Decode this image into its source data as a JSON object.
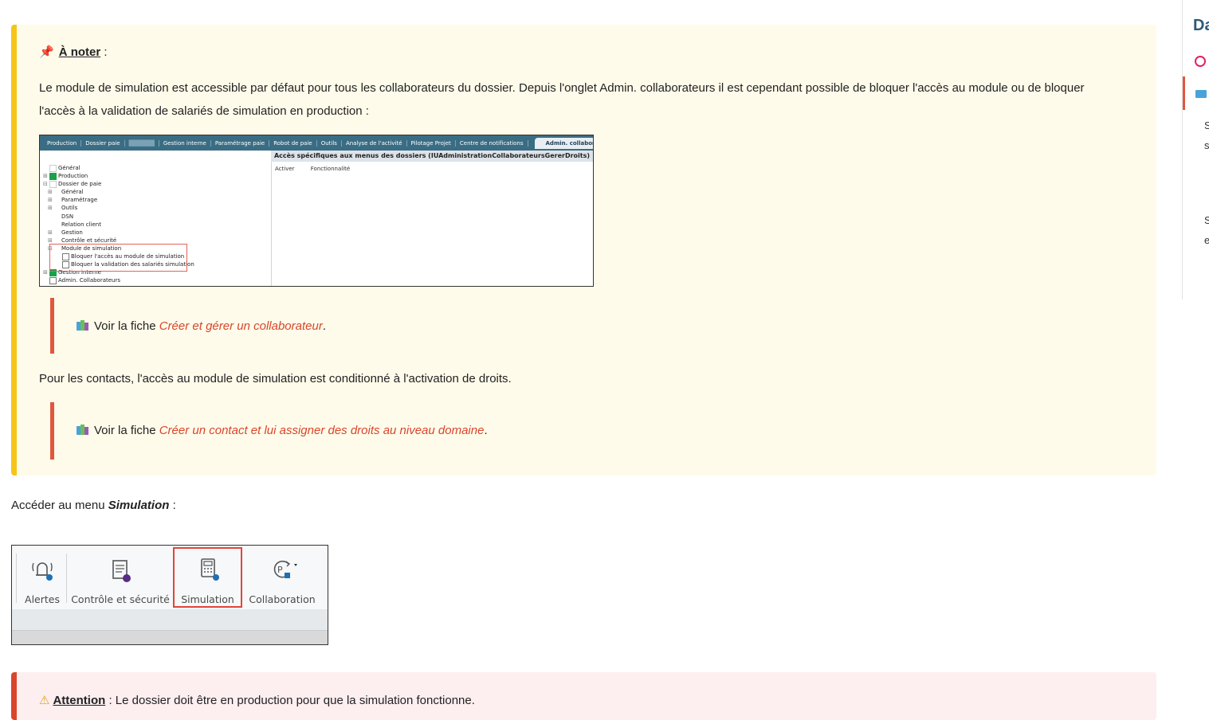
{
  "note": {
    "title": "À noter",
    "title_suffix": " :",
    "paragraph1_line1": "Le module de simulation est accessible par défaut pour tous les collaborateurs du dossier. Depuis l'onglet Admin. collaborateurs il est cependant possible de bloquer l'accès au module ou de bloquer",
    "paragraph1_line2": "l'accès à la validation de salariés de simulation en production :",
    "quote1_prefix": "Voir la fiche ",
    "quote1_link": "Créer et gérer un collaborateur",
    "quote1_suffix": ".",
    "paragraph2": "Pour les contacts, l'accès au module de simulation est conditionné à l'activation de droits.",
    "quote2_prefix": "Voir la fiche ",
    "quote2_link": "Créer un contact et lui assigner des droits au niveau domaine",
    "quote2_suffix": "."
  },
  "screenshot_admin": {
    "tabs": [
      "Production",
      "Dossier paie",
      "Gestion interne",
      "Paramétrage paie",
      "Robot de paie",
      "Outils",
      "Analyse de l'activité",
      "Pilotage Projet",
      "Centre de notifications"
    ],
    "active_tab": "Admin. collaborateurs",
    "header": "Accès spécifiques aux menus des dossiers (IUAdministrationCollaborateursGererDroits)",
    "col_activer": "Activer",
    "col_fonctionnalite": "Fonctionnalité",
    "tree": {
      "general": "Général",
      "production": "Production",
      "dossier_paie": "Dossier de paie",
      "sub_general": "Général",
      "parametrage": "Paramétrage",
      "outils": "Outils",
      "dsn": "DSN",
      "relation_client": "Relation client",
      "gestion": "Gestion",
      "controle": "Contrôle et sécurité",
      "module_simulation": "Module de simulation",
      "bloquer_acces": "Bloquer l'accès au module de simulation",
      "bloquer_validation": "Bloquer la validation des salariés simulation",
      "gestion_interne": "Gestion interne",
      "admin_collab": "Admin. Collaborateurs"
    }
  },
  "access": {
    "prefix": "Accéder au menu ",
    "menu": "Simulation",
    "suffix": " :"
  },
  "ribbon": {
    "alertes": "Alertes",
    "controle": "Contrôle et sécurité",
    "simulation": "Simulation",
    "collaboration": "Collaboration"
  },
  "attention": {
    "label": "Attention",
    "text": " : Le dossier doit être en production pour que la simulation fonctionne."
  },
  "sidebar": {
    "title": "Da",
    "letters": [
      "S",
      "s",
      "S",
      "e"
    ]
  },
  "colors": {
    "note_bg": "#fffbea",
    "note_border": "#f5c518",
    "quote_border": "#e0573f",
    "link": "#d9452b",
    "attention_bg": "#fdeef0"
  }
}
